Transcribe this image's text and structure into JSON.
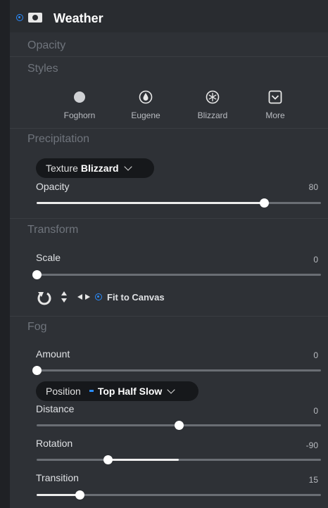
{
  "header": {
    "title": "Weather"
  },
  "sections": {
    "opacity": "Opacity",
    "styles": "Styles",
    "precipitation": "Precipitation",
    "transform": "Transform",
    "fog": "Fog"
  },
  "styles": [
    {
      "label": "Foghorn",
      "icon": "gray-circle-icon"
    },
    {
      "label": "Eugene",
      "icon": "drop-icon"
    },
    {
      "label": "Blizzard",
      "icon": "snowflake-icon"
    },
    {
      "label": "More",
      "icon": "chevron-box-icon"
    }
  ],
  "precipitation": {
    "texture_label": "Texture",
    "texture_value": "Blizzard",
    "opacity": {
      "label": "Opacity",
      "value": "80",
      "fraction": 0.8
    }
  },
  "transform": {
    "scale": {
      "label": "Scale",
      "value": "0",
      "fraction": 0
    },
    "fit_label": "Fit to Canvas"
  },
  "fog": {
    "amount": {
      "label": "Amount",
      "value": "0",
      "fraction": 0
    },
    "position_label": "Position",
    "position_value": "Top Half Slow",
    "distance": {
      "label": "Distance",
      "value": "0",
      "fraction": 0.5,
      "bipolar": true
    },
    "rotation": {
      "label": "Rotation",
      "value": "-90",
      "fraction": 0.25,
      "bipolar": true
    },
    "transition": {
      "label": "Transition",
      "value": "15",
      "fraction": 0.15
    }
  },
  "colors": {
    "accent": "#2a8cff",
    "background": "#2e3136",
    "pill": "#16181b"
  }
}
